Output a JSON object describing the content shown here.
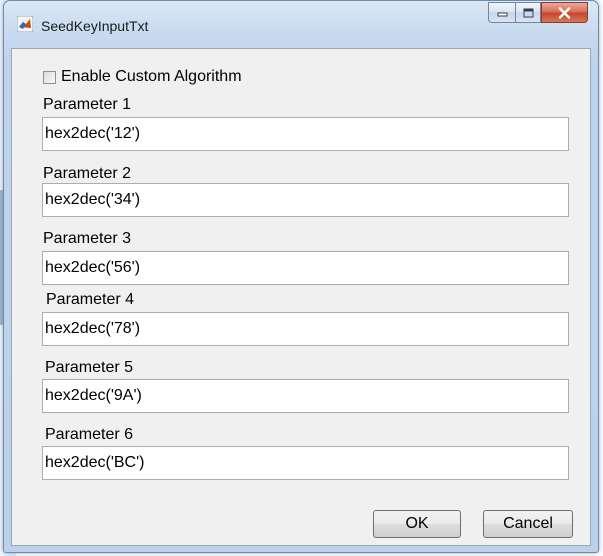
{
  "window": {
    "title": "SeedKeyInputTxt",
    "icon": "matlab-icon"
  },
  "caption_buttons": {
    "minimize_icon": "minimize-icon",
    "maximize_icon": "maximize-icon",
    "close_icon": "close-icon",
    "close_color": "#c7452d"
  },
  "checkbox": {
    "label": "Enable Custom Algorithm",
    "checked": false
  },
  "parameters": [
    {
      "label": "Parameter 1",
      "value": "hex2dec('12')"
    },
    {
      "label": "Parameter 2",
      "value": "hex2dec('34')"
    },
    {
      "label": "Parameter 3",
      "value": "hex2dec('56')"
    },
    {
      "label": "Parameter 4",
      "value": "hex2dec('78')"
    },
    {
      "label": "Parameter 5",
      "value": "hex2dec('9A')"
    },
    {
      "label": "Parameter 6",
      "value": "hex2dec('BC')"
    }
  ],
  "buttons": {
    "ok": "OK",
    "cancel": "Cancel"
  }
}
